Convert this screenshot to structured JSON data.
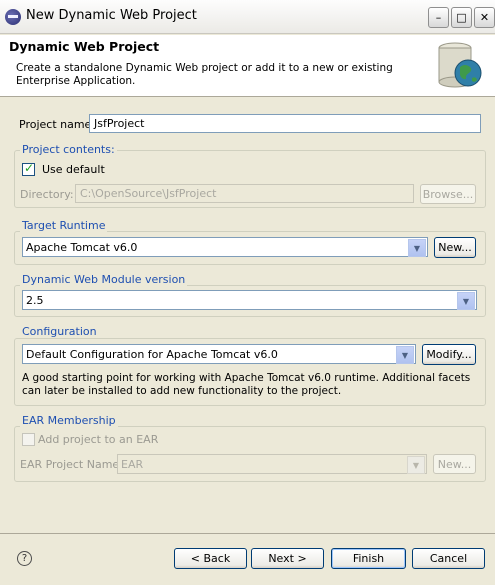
{
  "window": {
    "title": "New Dynamic Web Project",
    "minimize": "–",
    "maximize": "□",
    "close": "✕"
  },
  "header": {
    "title": "Dynamic Web Project",
    "description": "Create a standalone Dynamic Web project or add it to a new or existing Enterprise Application."
  },
  "project_name": {
    "label": "Project name:",
    "value": "JsfProject"
  },
  "project_contents": {
    "legend": "Project contents:",
    "use_default_label": "Use default",
    "use_default_checked": true,
    "directory_label": "Directory:",
    "directory_value": "C:\\OpenSource\\JsfProject",
    "browse_label": "Browse..."
  },
  "target_runtime": {
    "legend": "Target Runtime",
    "value": "Apache Tomcat v6.0",
    "new_label": "New..."
  },
  "web_module": {
    "legend": "Dynamic Web Module version",
    "value": "2.5"
  },
  "configuration": {
    "legend": "Configuration",
    "value": "Default Configuration for Apache Tomcat v6.0",
    "modify_label": "Modify...",
    "description": "A good starting point for working with Apache Tomcat v6.0 runtime. Additional facets can later be installed to add new functionality to the project."
  },
  "ear": {
    "legend": "EAR Membership",
    "add_label": "Add project to an EAR",
    "add_checked": false,
    "project_name_label": "EAR Project Name:",
    "project_name_value": "EAR",
    "new_label": "New..."
  },
  "footer": {
    "help": "?",
    "back": "< Back",
    "next": "Next >",
    "finish": "Finish",
    "cancel": "Cancel"
  }
}
